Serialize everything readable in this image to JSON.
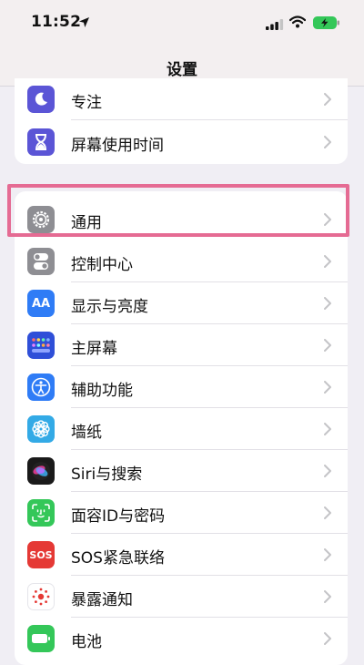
{
  "status_bar": {
    "time": "11:52"
  },
  "nav": {
    "title": "设置"
  },
  "group_top": [
    {
      "label": "专注",
      "icon": "moon-icon",
      "color": "#5b55d6"
    },
    {
      "label": "屏幕使用时间",
      "icon": "hourglass-icon",
      "color": "#5b55d6"
    }
  ],
  "group_main": [
    {
      "label": "通用",
      "icon": "gear-icon",
      "color": "#8e8e93"
    },
    {
      "label": "控制中心",
      "icon": "toggles-icon",
      "color": "#8e8e93"
    },
    {
      "label": "显示与亮度",
      "icon": "text-size-icon",
      "icon_text": "AA",
      "color": "#2f7cf6"
    },
    {
      "label": "主屏幕",
      "icon": "app-grid-icon",
      "color": "#2f4fd8"
    },
    {
      "label": "辅助功能",
      "icon": "accessibility-icon",
      "color": "#2f7cf6"
    },
    {
      "label": "墙纸",
      "icon": "flower-icon",
      "color": "#33aae6"
    },
    {
      "label": "Siri与搜索",
      "icon": "siri-icon",
      "color": "#1a1a1a"
    },
    {
      "label": "面容ID与密码",
      "icon": "face-id-icon",
      "color": "#34c759"
    },
    {
      "label": "SOS紧急联络",
      "icon": "sos-icon",
      "icon_text": "SOS",
      "color": "#e53935"
    },
    {
      "label": "暴露通知",
      "icon": "exposure-icon",
      "color": "#ffffff"
    },
    {
      "label": "电池",
      "icon": "battery-icon",
      "color": "#34c759"
    }
  ],
  "highlight_color": "#e56b93"
}
